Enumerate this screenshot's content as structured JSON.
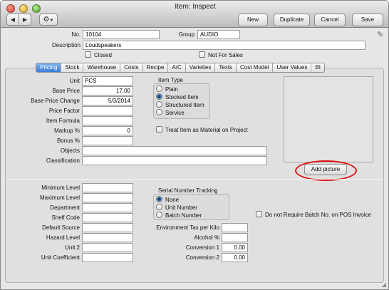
{
  "window": {
    "title": "Item: Inspect"
  },
  "toolbar": {
    "new": "New",
    "duplicate": "Duplicate",
    "cancel": "Cancel",
    "save": "Save"
  },
  "header": {
    "no_label": "No.",
    "no_value": "10104",
    "group_label": "Group",
    "group_value": "AUDIO",
    "description_label": "Description",
    "description_value": "Loudspeakers",
    "closed_label": "Closed",
    "not_for_sales_label": "Not For Sales"
  },
  "tabs": [
    "Pricing",
    "Stock",
    "Warehouse",
    "Costs",
    "Recipe",
    "A/C",
    "Varieties",
    "Texts",
    "Cost Model",
    "User Values",
    "BI"
  ],
  "active_tab": "Pricing",
  "pricing": {
    "unit_label": "Unit",
    "unit_value": "PCS",
    "base_price_label": "Base Price",
    "base_price_value": "17.00",
    "base_price_change_label": "Base Price Change",
    "base_price_change_value": "5/3/2014",
    "price_factor_label": "Price Factor",
    "price_factor_value": "",
    "item_formula_label": "Item Formula",
    "item_formula_value": "",
    "markup_label": "Markup %",
    "markup_value": "0",
    "bonus_label": "Bonus %",
    "bonus_value": "",
    "objects_label": "Objects",
    "objects_value": "",
    "classification_label": "Classification",
    "classification_value": ""
  },
  "item_type": {
    "title": "Item Type",
    "options": [
      "Plain",
      "Stocked Item",
      "Structured Item",
      "Service"
    ],
    "selected": "Stocked Item"
  },
  "treat_material_label": "Treat Item as Material on Project",
  "add_picture": "Add picture",
  "lower": {
    "minimum_level_label": "Minimum Level",
    "maximum_level_label": "Maximum Level",
    "department_label": "Department",
    "shelf_code_label": "Shelf Code",
    "default_source_label": "Default Source",
    "hazard_level_label": "Hazard Level",
    "unit2_label": "Unit 2",
    "unit_coefficient_label": "Unit Coefficient",
    "env_tax_label": "Environment Tax per Kilo",
    "env_tax_value": "",
    "alcohol_label": "Alcohol %",
    "alcohol_value": "",
    "conversion1_label": "Conversion 1",
    "conversion1_value": "0.00",
    "conversion2_label": "Conversion 2",
    "conversion2_value": "0.00"
  },
  "serial": {
    "title": "Serial Number Tracking",
    "options": [
      "None",
      "Unit Number",
      "Batch Number"
    ],
    "selected": "None"
  },
  "pos_batch_label": "Do not Require Batch No. on POS Invoice",
  "colors": {
    "highlight_ring": "#e01010",
    "active_tab": "#3b7dd8"
  }
}
